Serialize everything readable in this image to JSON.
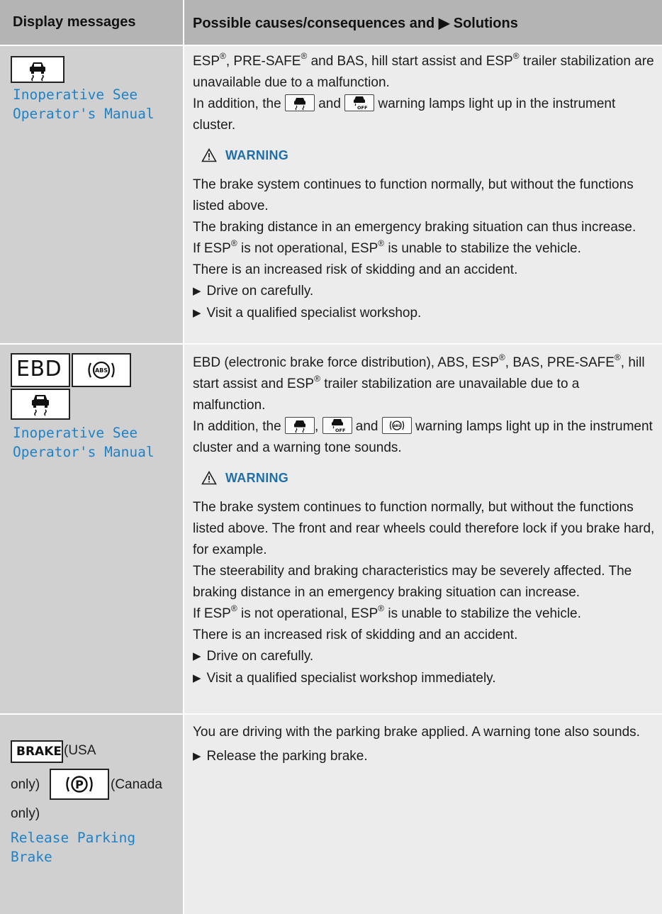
{
  "header": {
    "left": "Display messages",
    "right": "Possible causes/consequences and ▶ Solutions"
  },
  "row1": {
    "display": [
      "Inoperative See",
      "Operator's Manual"
    ],
    "intro1": "ESP®, PRE-SAFE® and BAS, hill start assist and ESP® trailer stabilization are unavailable due to a malfunction.",
    "intro2_a": "In addition, the",
    "intro2_b": "and",
    "intro2_c": "warning lamps light up in the instrument cluster.",
    "warning_label": "WARNING",
    "p1": "The brake system continues to function normally, but without the functions listed above.",
    "p2": "The braking distance in an emergency braking situation can thus increase.",
    "p3": "If ESP® is not operational, ESP® is unable to stabilize the vehicle.",
    "p4": "There is an increased risk of skidding and an accident.",
    "b1": "Drive on carefully.",
    "b2": "Visit a qualified specialist workshop."
  },
  "row2": {
    "ebd": "EBD",
    "abs": "ABS",
    "display": [
      "Inoperative See",
      "Operator's Manual"
    ],
    "intro1": "EBD (electronic brake force distribution), ABS, ESP®, BAS, PRE-SAFE®, hill start assist and ESP® trailer stabilization are unavailable due to a malfunction.",
    "intro2_a": "In addition, the",
    "intro2_b": ",",
    "intro2_c": "and",
    "intro2_d": "warning lamps light up in the instrument cluster and a warning tone sounds.",
    "warning_label": "WARNING",
    "p1": "The brake system continues to function normally, but without the functions listed above. The front and rear wheels could therefore lock if you brake hard, for example.",
    "p2": "The steerability and braking characteristics may be severely affected. The braking distance in an emergency braking situation can increase.",
    "p3": "If ESP® is not operational, ESP® is unable to stabilize the vehicle.",
    "p4": "There is an increased risk of skidding and an accident.",
    "b1": "Drive on carefully.",
    "b2": "Visit a qualified specialist workshop immediately."
  },
  "row3": {
    "brake": "BRAKE",
    "usa": "(USA",
    "only1": "only)",
    "canada": "(Canada",
    "only2": "only)",
    "display": [
      "Release Parking",
      "Brake"
    ],
    "p1": "You are driving with the parking brake applied. A warning tone also sounds.",
    "b1": "Release the parking brake."
  }
}
